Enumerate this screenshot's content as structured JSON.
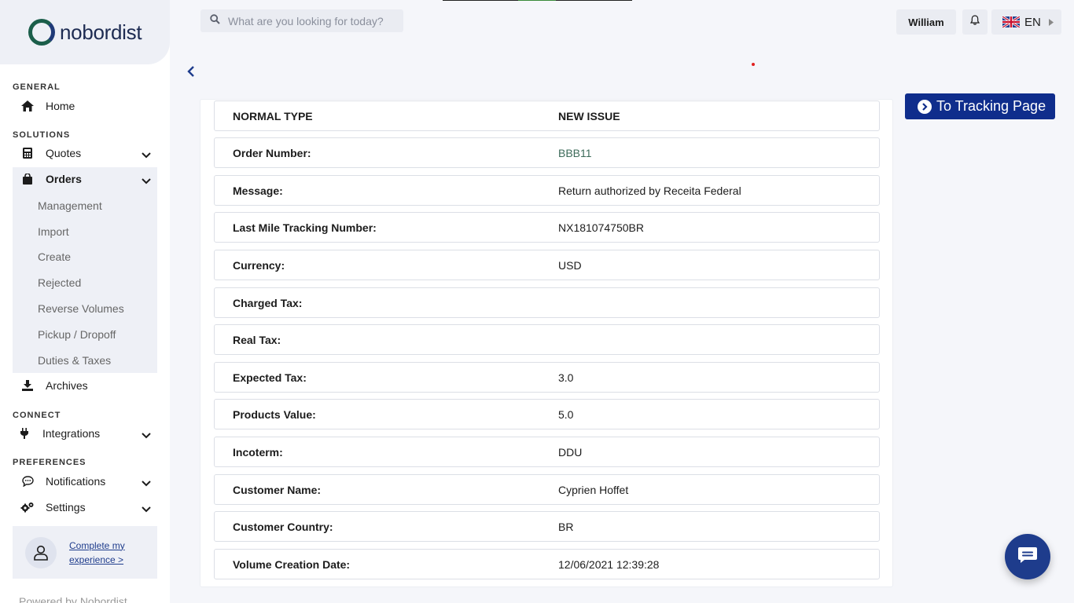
{
  "brand": {
    "name": "nobordist"
  },
  "sidebar": {
    "sections": {
      "general": "GENERAL",
      "solutions": "SOLUTIONS",
      "connect": "CONNECT",
      "preferences": "PREFERENCES"
    },
    "home": "Home",
    "quotes": "Quotes",
    "orders": "Orders",
    "orders_sub": [
      "Management",
      "Import",
      "Create",
      "Rejected",
      "Reverse Volumes",
      "Pickup / Dropoff",
      "Duties & Taxes"
    ],
    "archives": "Archives",
    "integrations": "Integrations",
    "notifications": "Notifications",
    "settings": "Settings",
    "profile_link": "Complete my experience >",
    "powered": "Powered by Nobordist"
  },
  "header": {
    "search_placeholder": "What are you looking for today?",
    "user": "William",
    "language": "EN"
  },
  "actions": {
    "tracking_button": "To Tracking Page"
  },
  "details": {
    "header": {
      "type": "NORMAL TYPE",
      "status": "NEW ISSUE"
    },
    "rows": [
      {
        "label": "Order Number:",
        "value": "BBB11"
      },
      {
        "label": "Message:",
        "value": "Return authorized by Receita Federal"
      },
      {
        "label": "Last Mile Tracking Number:",
        "value": "NX181074750BR"
      },
      {
        "label": "Currency:",
        "value": "USD"
      },
      {
        "label": "Charged Tax:",
        "value": ""
      },
      {
        "label": "Real Tax:",
        "value": ""
      },
      {
        "label": "Expected Tax:",
        "value": "3.0"
      },
      {
        "label": "Products Value:",
        "value": "5.0"
      },
      {
        "label": "Incoterm:",
        "value": "DDU"
      },
      {
        "label": "Customer Name:",
        "value": "Cyprien Hoffet"
      },
      {
        "label": "Customer Country:",
        "value": "BR"
      },
      {
        "label": "Volume Creation Date:",
        "value": "12/06/2021 12:39:28"
      }
    ]
  },
  "colors": {
    "primary": "#0f2d8c",
    "sidebar_active": "#eef0f6",
    "background": "#f5f6fa"
  }
}
